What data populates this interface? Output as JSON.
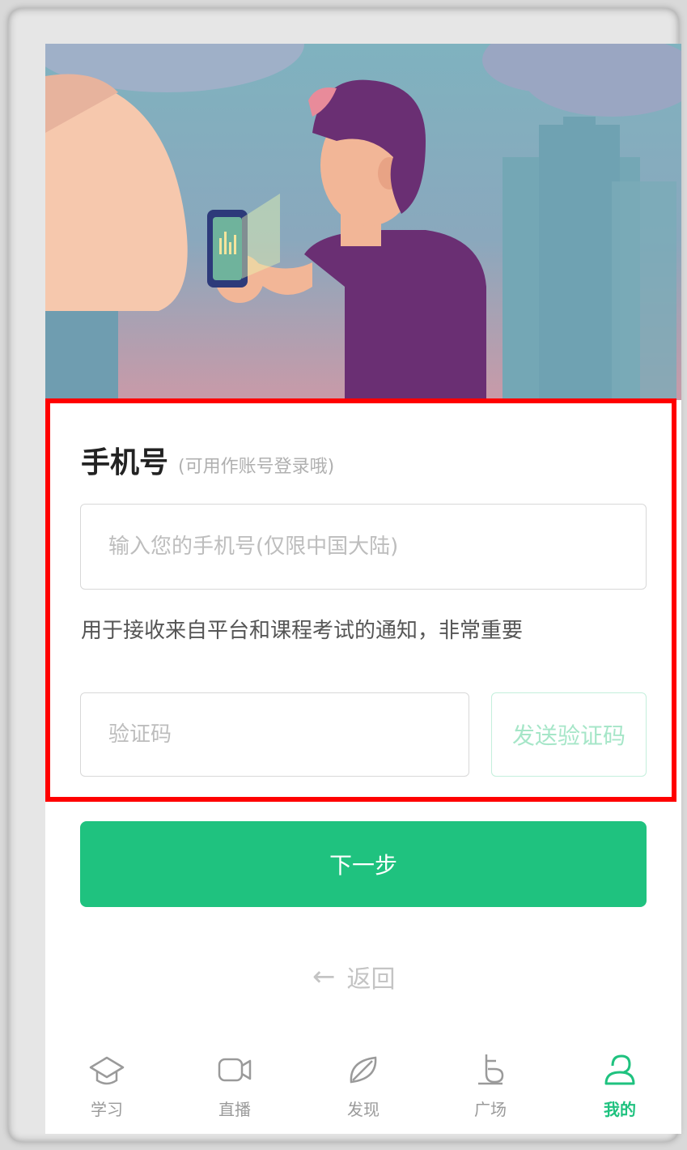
{
  "form": {
    "phone_label": "手机号",
    "phone_hint": "(可用作账号登录哦)",
    "phone_placeholder": "输入您的手机号(仅限中国大陆)",
    "phone_value": "",
    "notice": "用于接收来自平台和课程考试的通知，非常重要",
    "code_placeholder": "验证码",
    "code_value": "",
    "send_code_label": "发送验证码",
    "next_label": "下一步",
    "back_label": "返回"
  },
  "tabbar": {
    "items": [
      {
        "label": "学习",
        "icon": "graduation-cap-icon"
      },
      {
        "label": "直播",
        "icon": "video-camera-icon"
      },
      {
        "label": "发现",
        "icon": "compass-leaf-icon"
      },
      {
        "label": "广场",
        "icon": "plaza-icon"
      },
      {
        "label": "我的",
        "icon": "user-profile-icon",
        "active": true
      }
    ]
  },
  "colors": {
    "accent": "#1fc27f",
    "highlight_border": "#ff0000"
  }
}
